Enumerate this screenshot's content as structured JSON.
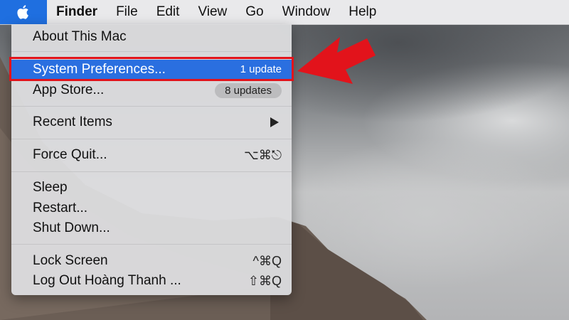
{
  "menubar": {
    "apple_icon": "apple-logo-icon",
    "items": [
      "Finder",
      "File",
      "Edit",
      "View",
      "Go",
      "Window",
      "Help"
    ]
  },
  "apple_menu": {
    "about": "About This Mac",
    "system_preferences": {
      "label": "System Preferences...",
      "badge": "1 update"
    },
    "app_store": {
      "label": "App Store...",
      "badge": "8 updates"
    },
    "recent_items": "Recent Items",
    "force_quit": {
      "label": "Force Quit...",
      "shortcut": "⌥⌘⎋"
    },
    "sleep": "Sleep",
    "restart": "Restart...",
    "shut_down": "Shut Down...",
    "lock_screen": {
      "label": "Lock Screen",
      "shortcut": "^⌘Q"
    },
    "log_out": {
      "label": "Log Out Hoàng Thanh ...",
      "shortcut": "⇧⌘Q"
    }
  },
  "colors": {
    "highlight": "#2a6fe0",
    "annotation_red": "#e2131b",
    "menubar_bg": "#e9e9eb"
  }
}
